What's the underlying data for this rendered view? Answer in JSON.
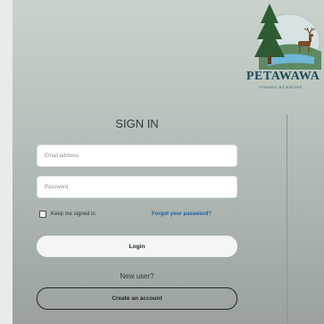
{
  "logo": {
    "name": "PETAWAWA",
    "tagline": "DYNAMIC BY NATURE",
    "icon": "tree-and-deer-emblem"
  },
  "form": {
    "title": "SIGN IN",
    "email_placeholder": "Email address",
    "password_placeholder": "Password",
    "remember_label": "Keep me signed in",
    "forgot_label": "Forgot your password?",
    "login_label": "Login",
    "new_user_text": "New user?",
    "create_account_label": "Create an account"
  },
  "colors": {
    "link": "#1d5fa0",
    "button_bg": "#f4f6f4"
  }
}
